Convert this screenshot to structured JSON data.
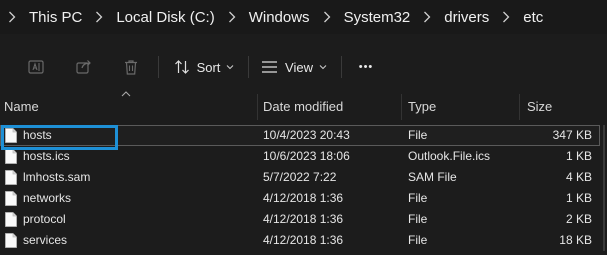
{
  "breadcrumb": [
    "This PC",
    "Local Disk (C:)",
    "Windows",
    "System32",
    "drivers",
    "etc"
  ],
  "toolbar": {
    "sort_label": "Sort",
    "view_label": "View",
    "more_label": "•••"
  },
  "columns": {
    "name": "Name",
    "date_modified": "Date modified",
    "type": "Type",
    "size": "Size"
  },
  "files": [
    {
      "name": "hosts",
      "date": "10/4/2023 20:43",
      "type": "File",
      "size": "347 KB",
      "selected": true
    },
    {
      "name": "hosts.ics",
      "date": "10/6/2023 18:06",
      "type": "Outlook.File.ics",
      "size": "1 KB",
      "selected": false
    },
    {
      "name": "lmhosts.sam",
      "date": "5/7/2022 7:22",
      "type": "SAM File",
      "size": "4 KB",
      "selected": false
    },
    {
      "name": "networks",
      "date": "4/12/2018 1:36",
      "type": "File",
      "size": "1 KB",
      "selected": false
    },
    {
      "name": "protocol",
      "date": "4/12/2018 1:36",
      "type": "File",
      "size": "2 KB",
      "selected": false
    },
    {
      "name": "services",
      "date": "4/12/2018 1:36",
      "type": "File",
      "size": "18 KB",
      "selected": false
    }
  ],
  "colors": {
    "background": "#1c1c1c",
    "focus_outline": "#1e90d6"
  }
}
